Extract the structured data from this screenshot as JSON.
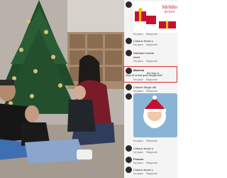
{
  "post_photo": {
    "alt_subject": "family-christmas-tree-photo"
  },
  "banner": {
    "line1": "Sărbăto",
    "line2": "fericire"
  },
  "comments": [
    {
      "name": "",
      "text": "",
      "actions": [
        "",
        "",
        ""
      ]
    },
    {
      "name": "",
      "text": "Crăciun fericit ș",
      "actions": [
        "Îmi place",
        "Răspunde",
        "1 zi"
      ]
    },
    {
      "name": "",
      "text": "Sărbători fericite",
      "actions": [
        "Îmi place",
        "Răspunde",
        "1 zi"
      ]
    },
    {
      "name": "",
      "text": "",
      "actions": [
        "Îmi place",
        "Răspunde",
        "1 zi"
      ]
    },
    {
      "name": "Marlena",
      "text": "the boy cr",
      "text2": "back he is bad quiet dengle tree!",
      "actions": [
        "Îmi place",
        "Răspunde",
        "1 zi"
      ]
    },
    {
      "name": "",
      "text": "Crăciun Magic ală",
      "actions": [
        "Îmi place",
        "Răspunde",
        "1 zi"
      ]
    },
    {
      "name": "",
      "text": "",
      "actions": [
        "Îmi place",
        "Răspunde",
        "1 zi"
      ]
    },
    {
      "name": "",
      "text": "Crăciun fericit a",
      "actions": [
        "Îmi place",
        "Răspunde",
        "1 zi"
      ]
    },
    {
      "name": "Fericire",
      "text": "",
      "actions": [
        "Îmi place",
        "Răspunde",
        "1 zi"
      ]
    },
    {
      "name": "",
      "text": "Crăciun fericit ș",
      "actions": [
        "Îmi place",
        "Răspunde",
        "1 zi"
      ]
    }
  ],
  "colors": {
    "highlight": "#e32b2b",
    "link": "#65676b",
    "panel_bg": "#f4f4f5"
  }
}
